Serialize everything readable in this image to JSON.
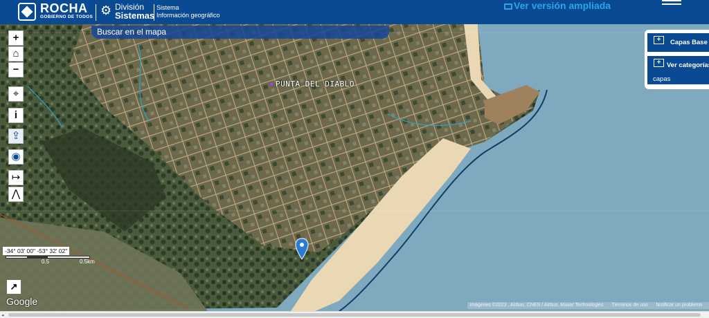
{
  "header": {
    "brand": "ROCHA",
    "brand_sub": "GOBIERNO DE TODOS",
    "division_line1": "División",
    "division_line2": "Sistemas",
    "system_line1": "Sistema",
    "system_line2": "Información geográfico",
    "wide_view_link": "Ver versión ampliada"
  },
  "map": {
    "search_placeholder": "Buscar en el mapa",
    "place_label": "PUNTA DEL DIABLO",
    "coordinates": "-34° 03' 00\" -53° 32' 02\"",
    "scale_label_1": "0.5",
    "scale_label_2": "0.5km",
    "google": "Google",
    "attribution": [
      "Imágenes ©2023 , Airbus, CNES / Airbus, Maxar Technologies",
      "Términos de uso",
      "Notificar un problema"
    ]
  },
  "toolbar": {
    "zoom_in": "+",
    "home": "⌂",
    "zoom_out": "−",
    "info": "i",
    "measure": "↦"
  },
  "layers_panel": {
    "base_layers": "Capas Base",
    "categories_line1": "Ver categorías",
    "categories_line2": "capas"
  },
  "colors": {
    "header_bg": "#0a4a93",
    "accent": "#29a6e8",
    "water": "#86b3c7",
    "sand": "#ead7b4"
  }
}
